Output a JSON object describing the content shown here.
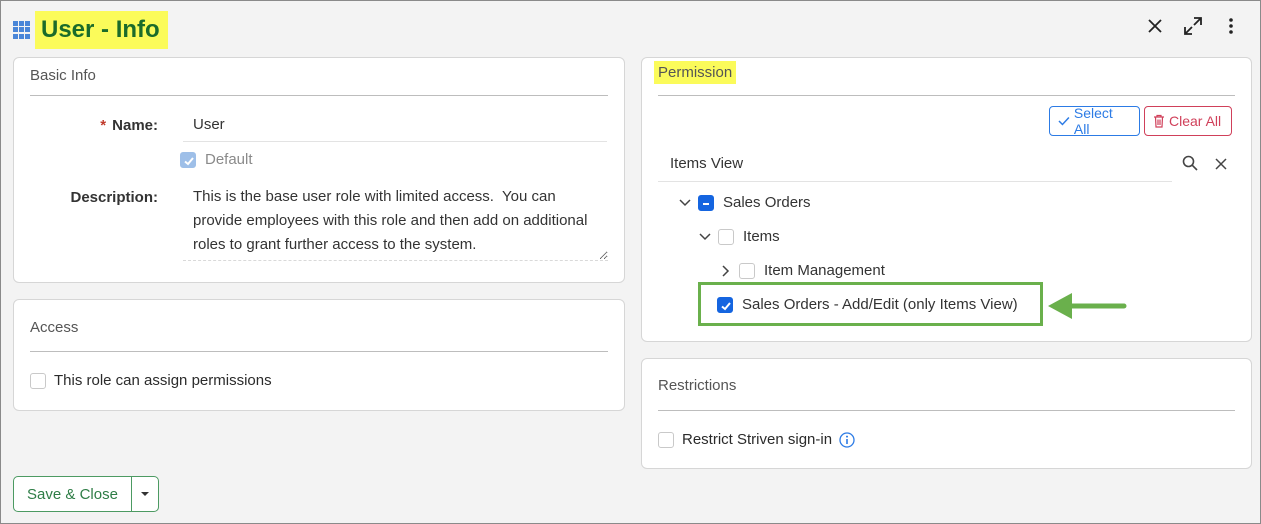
{
  "header": {
    "title": "User - Info"
  },
  "window": {
    "close_icon": "close-icon",
    "maximize_icon": "expand-icon",
    "menu_icon": "more-vertical-icon"
  },
  "basic_info": {
    "title": "Basic Info",
    "name_label": "Name:",
    "name_required_mark": "*",
    "name_value": "User",
    "default_label": "Default",
    "default_checked": true,
    "description_label": "Description:",
    "description_value": "This is the base user role with limited access.  You can provide employees with this role and then add on additional roles to grant further access to the system."
  },
  "access": {
    "title": "Access",
    "assign_permissions_label": "This role can assign permissions",
    "assign_permissions_checked": false
  },
  "permission": {
    "title": "Permission",
    "select_all_label": "Select All",
    "clear_all_label": "Clear All",
    "search_value": "Items View",
    "tree": {
      "sales_orders": "Sales Orders",
      "items": "Items",
      "item_management": "Item Management",
      "sales_orders_add_edit": "Sales Orders - Add/Edit (only Items View)"
    }
  },
  "restrictions": {
    "title": "Restrictions",
    "restrict_signin_label": "Restrict Striven sign-in",
    "restrict_signin_checked": false
  },
  "footer": {
    "save_close_label": "Save & Close"
  },
  "colors": {
    "highlight": "#fbfb5a",
    "title_green": "#1b6b2a",
    "accent_blue": "#1565e0",
    "annotation_green": "#6ab04c",
    "danger": "#d0405a"
  }
}
